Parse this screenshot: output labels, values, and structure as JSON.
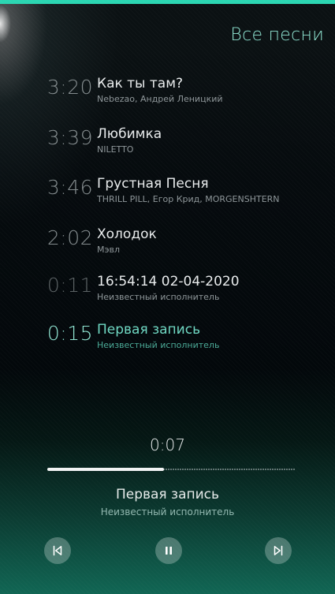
{
  "header": {
    "title": "Все песни"
  },
  "tracks": [
    {
      "duration": "3:20",
      "title": "Как ты там?",
      "artist": "Nebezao, Андрей Леницкий",
      "state": "normal"
    },
    {
      "duration": "3:39",
      "title": "Любимка",
      "artist": "NILETTO",
      "state": "normal"
    },
    {
      "duration": "3:46",
      "title": "Грустная Песня",
      "artist": "THRILL PILL, Егор Крид, MORGENSHTERN",
      "state": "normal"
    },
    {
      "duration": "2:02",
      "title": "Холодок",
      "artist": "Мэвл",
      "state": "normal"
    },
    {
      "duration": "0:11",
      "title": "16:54:14 02-04-2020",
      "artist": "Неизвестный исполнитель",
      "state": "dim"
    },
    {
      "duration": "0:15",
      "title": "Первая запись",
      "artist": "Неизвестный исполнитель",
      "state": "active"
    }
  ],
  "player": {
    "elapsed": "0:07",
    "progress_fraction": 0.47,
    "title": "Первая запись",
    "artist": "Неизвестный исполнитель",
    "controls": {
      "previous_icon": "skip-previous-icon",
      "pause_icon": "pause-icon",
      "next_icon": "skip-next-icon"
    }
  },
  "colors": {
    "accent": "#2bd6b2",
    "highlight_text": "#6fd8c3",
    "background_top": "#0b1113",
    "background_bottom": "#116654"
  }
}
